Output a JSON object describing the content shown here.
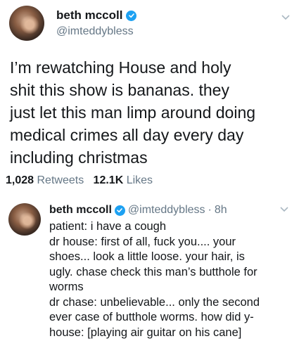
{
  "tweet1": {
    "name": "beth mccoll",
    "handle": "@imteddybless",
    "lines": [
      "I’m rewatching House and holy",
      "shit this show is bananas. they",
      "just let this man limp around doing",
      "medical crimes all day every day",
      "including christmas"
    ],
    "retweets_count": "1,028",
    "retweets_label": "Retweets",
    "likes_count": "12.1K",
    "likes_label": "Likes"
  },
  "tweet2": {
    "name": "beth mccoll",
    "handle": "@imteddybless",
    "separator": "·",
    "time": "8h",
    "lines": [
      "patient: i have a cough",
      "dr house: first of all, fuck you.... your",
      "shoes... look a little loose. your hair, is",
      "ugly. chase check this man’s butthole for",
      "worms",
      "dr chase: unbelievable... only the second",
      "ever case of butthole worms. how did y-",
      "house: [playing air guitar on his cane]"
    ]
  },
  "colors": {
    "verified": "#1da1f2",
    "secondary_text": "#657786",
    "primary_text": "#14171a"
  },
  "icons": [
    "avatar",
    "verified-badge-icon",
    "chevron-down-icon"
  ]
}
